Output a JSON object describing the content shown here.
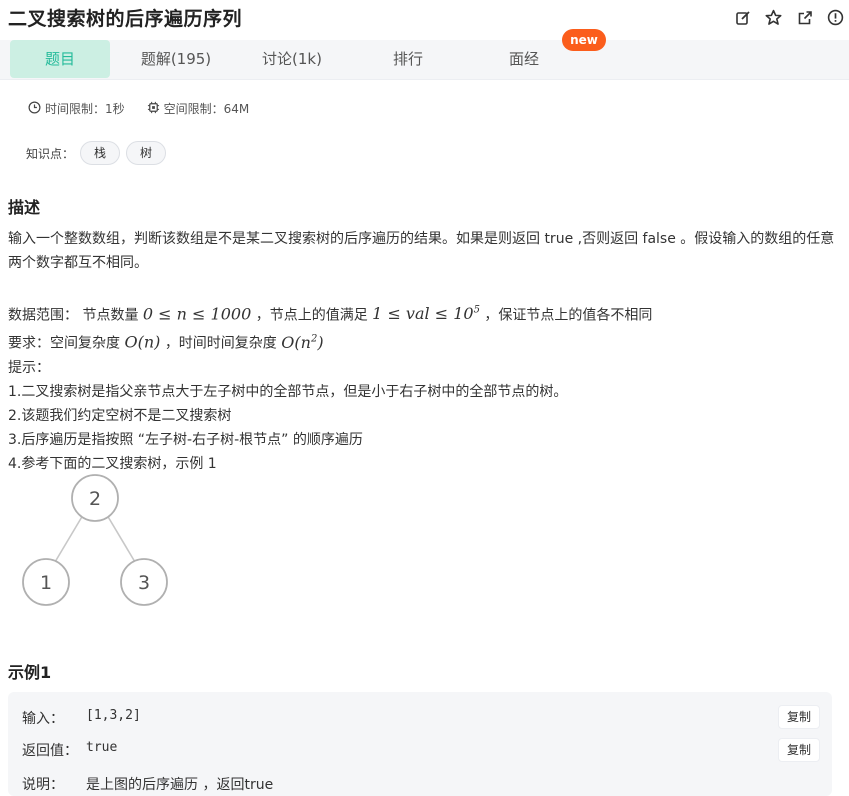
{
  "header": {
    "title": "二叉搜索树的后序遍历序列",
    "icons": [
      "edit-icon",
      "star-icon",
      "share-icon",
      "report-icon"
    ]
  },
  "tabs": [
    {
      "label": "题目",
      "active": true
    },
    {
      "label": "题解(195)",
      "active": false
    },
    {
      "label": "讨论(1k)",
      "active": false
    },
    {
      "label": "排行",
      "active": false
    },
    {
      "label": "面经",
      "active": false
    }
  ],
  "badge": "new",
  "limits": {
    "time": "时间限制：1秒",
    "space": "空间限制：64M"
  },
  "knowledge": {
    "label": "知识点：",
    "tags": [
      "栈",
      "树"
    ]
  },
  "description": {
    "title": "描述",
    "line1": "输入一个整数数组，判断该数组是不是某二叉搜索树的后序遍历的结果。如果是则返回 true ,否则返回 false 。假设输入的数组的任意两个数字都互不相同。",
    "range_prefix": "数据范围：  节点数量",
    "range_math1": "0 ≤ n ≤ 1000",
    "range_mid": "，节点上的值满足",
    "range_math2_base": "1 ≤ val ≤ 10",
    "range_math2_exp": "5",
    "range_suffix": "，保证节点上的值各不相同",
    "req_prefix": "要求：空间复杂度",
    "req_math1": "O(n)",
    "req_mid": "，时间时间复杂度",
    "req_math2_base": "O(n",
    "req_math2_exp": "2",
    "req_math2_close": ")",
    "hint_title": "提示：",
    "hints": [
      "1.二叉搜索树是指父亲节点大于左子树中的全部节点，但是小于右子树中的全部节点的树。",
      "2.该题我们约定空树不是二叉搜索树",
      "3.后序遍历是指按照 “左子树-右子树-根节点” 的顺序遍历",
      "4.参考下面的二叉搜索树，示例 1"
    ]
  },
  "tree": {
    "root": "2",
    "left": "1",
    "right": "3"
  },
  "example": {
    "title": "示例1",
    "input_label": "输入：",
    "input_value": "[1,3,2]",
    "return_label": "返回值：",
    "return_value": "true",
    "explain_label": "说明：",
    "explain_value": "是上图的后序遍历 ，返回true",
    "copy_label": "复制"
  },
  "colors": {
    "accent": "#25bb9b",
    "active_tab_bg": "#ccefe3",
    "badge": "#fb5d1c"
  }
}
